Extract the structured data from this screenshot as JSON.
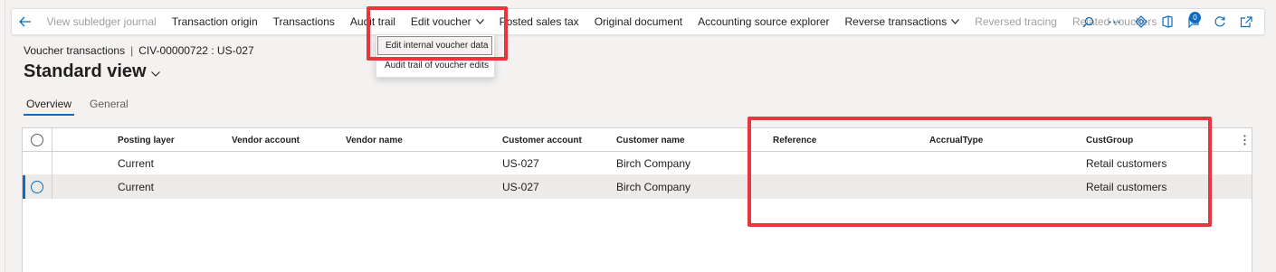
{
  "toolbar": {
    "items": [
      {
        "label": "View subledger journal",
        "disabled": true
      },
      {
        "label": "Transaction origin",
        "disabled": false
      },
      {
        "label": "Transactions",
        "disabled": false
      },
      {
        "label": "Audit trail",
        "disabled": false
      },
      {
        "label": "Edit voucher",
        "disabled": false,
        "has_chevron": true
      },
      {
        "label": "Posted sales tax",
        "disabled": false
      },
      {
        "label": "Original document",
        "disabled": false
      },
      {
        "label": "Accounting source explorer",
        "disabled": false
      },
      {
        "label": "Reverse transactions",
        "disabled": false,
        "has_chevron": true
      },
      {
        "label": "Reversed tracing",
        "disabled": true
      },
      {
        "label": "Related vouchers",
        "disabled": true
      }
    ],
    "right_icons": [
      "search-icon",
      "more-icon",
      "diamond-icon",
      "office-icon",
      "notification-icon",
      "refresh-icon",
      "open-new-window-icon"
    ],
    "notification_count": "0"
  },
  "edit_voucher_menu": {
    "items": [
      "Edit internal voucher data",
      "Audit trail of voucher edits"
    ]
  },
  "breadcrumb": {
    "page": "Voucher transactions",
    "separator": "|",
    "record": "CIV-00000722 : US-027"
  },
  "view": {
    "title": "Standard view"
  },
  "tabs": [
    {
      "label": "Overview",
      "active": true
    },
    {
      "label": "General",
      "active": false
    }
  ],
  "grid": {
    "columns": [
      "Posting layer",
      "Vendor account",
      "Vendor name",
      "Customer account",
      "Customer name",
      "Reference",
      "AccrualType",
      "CustGroup"
    ],
    "rows": [
      {
        "posting_layer": "Current",
        "vendor_account": "",
        "vendor_name": "",
        "customer_account": "US-027",
        "customer_name": "Birch Company",
        "reference": "",
        "accrual_type": "",
        "cust_group": "Retail customers",
        "selected": false
      },
      {
        "posting_layer": "Current",
        "vendor_account": "",
        "vendor_name": "",
        "customer_account": "US-027",
        "customer_name": "Birch Company",
        "reference": "",
        "accrual_type": "",
        "cust_group": "Retail customers",
        "selected": true
      }
    ]
  },
  "colors": {
    "accent": "#0f6cbd",
    "highlight_box": "#e8363f",
    "background": "#f3f2f1"
  }
}
